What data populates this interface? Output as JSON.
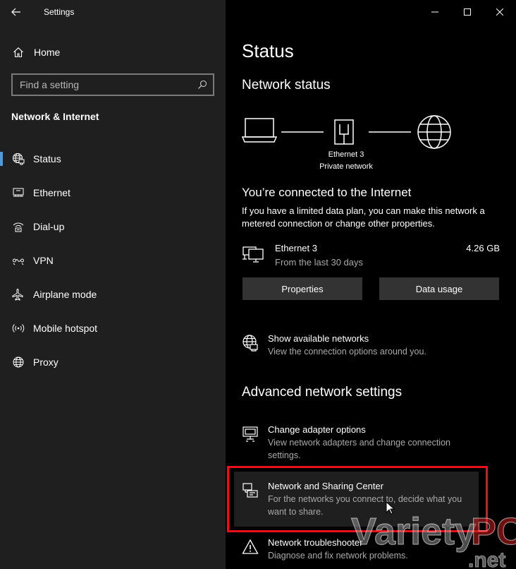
{
  "app": {
    "title": "Settings"
  },
  "sidebar": {
    "home_label": "Home",
    "search_placeholder": "Find a setting",
    "section_title": "Network & Internet",
    "items": [
      {
        "label": "Status",
        "icon": "globe-status-icon",
        "active": true
      },
      {
        "label": "Ethernet",
        "icon": "ethernet-icon"
      },
      {
        "label": "Dial-up",
        "icon": "dialup-icon"
      },
      {
        "label": "VPN",
        "icon": "vpn-icon"
      },
      {
        "label": "Airplane mode",
        "icon": "airplane-icon"
      },
      {
        "label": "Mobile hotspot",
        "icon": "hotspot-icon"
      },
      {
        "label": "Proxy",
        "icon": "globe-icon"
      }
    ]
  },
  "main": {
    "page_title": "Status",
    "network_status_heading": "Network status",
    "diagram": {
      "adapter_name": "Ethernet 3",
      "network_type": "Private network"
    },
    "connected_heading": "You’re connected to the Internet",
    "connected_text_line1": "If you have a limited data plan, you can make this network a",
    "connected_text_line2": "metered connection or change other properties.",
    "adapter": {
      "name": "Ethernet 3",
      "subtitle": "From the last 30 days",
      "usage": "4.26 GB"
    },
    "buttons": {
      "properties": "Properties",
      "data_usage": "Data usage"
    },
    "show_networks": {
      "title": "Show available networks",
      "desc": "View the connection options around you."
    },
    "advanced_heading": "Advanced network settings",
    "adapter_options": {
      "title": "Change adapter options",
      "desc": "View network adapters and change connection settings."
    },
    "sharing_center": {
      "title": "Network and Sharing Center",
      "desc": "For the networks you connect to, decide what you want to share."
    },
    "troubleshooter": {
      "title": "Network troubleshooter",
      "desc": "Diagnose and fix network problems."
    }
  },
  "watermark": {
    "text1": "Variety",
    "text2": "PC",
    "text3": ".net"
  },
  "colors": {
    "accent": "#4f9ad8",
    "highlight": "#e8101a",
    "sidebar_bg": "#1f1f1f"
  }
}
